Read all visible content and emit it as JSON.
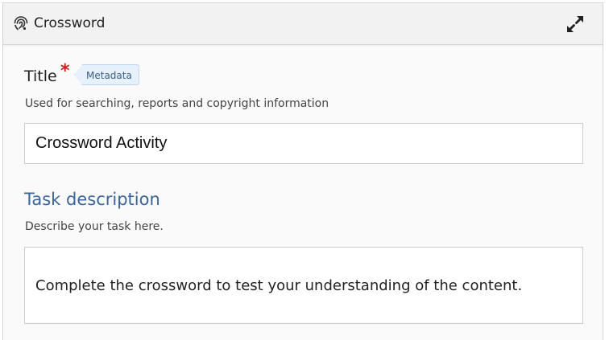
{
  "header": {
    "title": "Crossword",
    "library_icon": "crossword-fingerprint-icon",
    "expand_icon": "expand-arrows-icon"
  },
  "title_field": {
    "label": "Title",
    "required_mark": "*",
    "metadata_label": "Metadata",
    "description": "Used for searching, reports and copyright information",
    "value": "Crossword Activity"
  },
  "task_field": {
    "heading": "Task description",
    "description": "Describe your task here.",
    "value": "Complete the crossword to test your understanding of the content."
  },
  "colors": {
    "heading_blue": "#3c6497",
    "required_red": "#cc1e1e",
    "metadata_bg": "#e7f1fb"
  }
}
